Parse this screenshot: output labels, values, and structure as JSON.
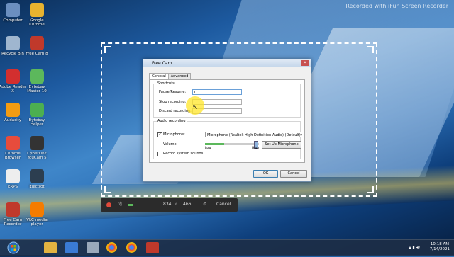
{
  "watermark": "Recorded with iFun Screen Recorder",
  "desktop_icons": [
    {
      "label": "Computer",
      "color": "#6b8fc0"
    },
    {
      "label": "Google Chrome",
      "color": "#e8b32f"
    },
    {
      "label": "Recycle Bin",
      "color": "#9fb6cf"
    },
    {
      "label": "Free Cam 8",
      "color": "#c0392b"
    },
    {
      "label": "Adobe Reader X",
      "color": "#d32f2f"
    },
    {
      "label": "Bytebay Master 10",
      "color": "#5cb85c"
    },
    {
      "label": "Audacity",
      "color": "#f39c12"
    },
    {
      "label": "Bytebay Helper",
      "color": "#4caf50"
    },
    {
      "label": "Chrome Browser",
      "color": "#e74c3c"
    },
    {
      "label": "CyberLink YouCam 5",
      "color": "#333333"
    },
    {
      "label": "ERPS",
      "color": "#eeeeee"
    },
    {
      "label": "Electrot",
      "color": "#2c3e50"
    },
    {
      "label": "Free Cam Recorder",
      "color": "#c0392b"
    },
    {
      "label": "VLC media player",
      "color": "#f57c00"
    }
  ],
  "dialog": {
    "title": "Free Cam",
    "tabs": [
      "General",
      "Advanced"
    ],
    "shortcuts": {
      "group_label": "Shortcuts",
      "pause_label": "Pause/Resume:",
      "pause_value": "I",
      "stop_label": "Stop recording:",
      "stop_value": "",
      "discard_label": "Discard recording:",
      "discard_value": ""
    },
    "audio": {
      "group_label": "Audio recording",
      "microphone_label": "Microphone:",
      "microphone_checked": true,
      "microphone_device": "Microphone (Realtek High Definition Audio) (Default)",
      "volume_label": "Volume:",
      "volume_fraction": 0.95,
      "volume_level_fraction": 0.35,
      "low_label": "Low",
      "high_label": "High",
      "setup_button": "Set Up Microphone",
      "system_sounds_label": "Record system sounds",
      "system_sounds_checked": false
    },
    "ok_button": "OK",
    "cancel_button": "Cancel"
  },
  "toolbar": {
    "width": "834",
    "separator": "x",
    "height": "466",
    "cancel_label": "Cancel"
  },
  "taskbar": {
    "time": "10:18 AM",
    "date": "7/14/2021"
  }
}
